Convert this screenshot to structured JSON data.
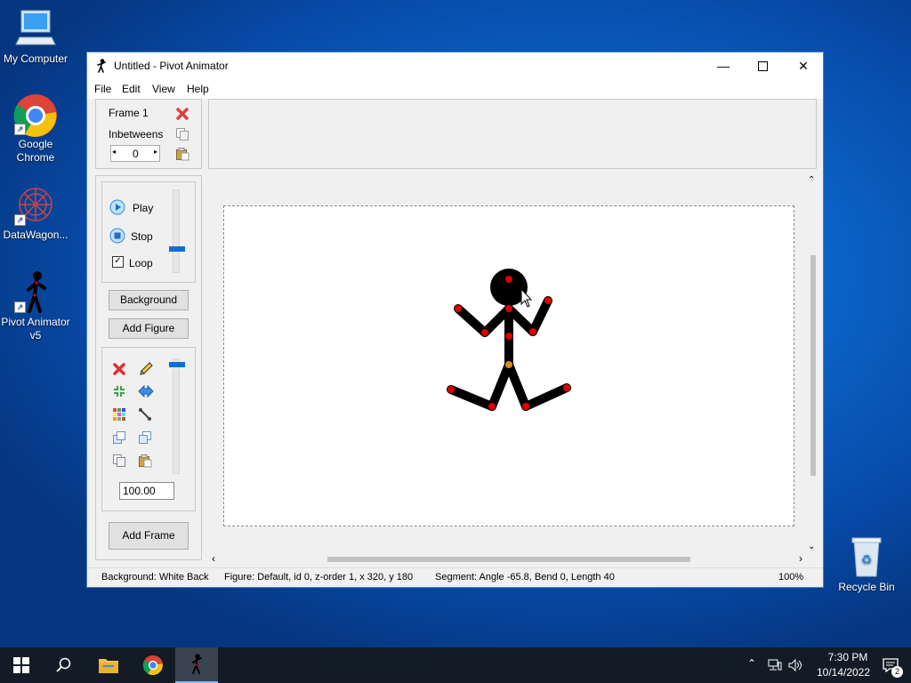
{
  "desktop": {
    "icons": [
      {
        "label": "My Computer"
      },
      {
        "label": "Google Chrome"
      },
      {
        "label": "DataWagon..."
      },
      {
        "label": "Pivot Animator v5"
      },
      {
        "label": "Recycle Bin"
      }
    ]
  },
  "window": {
    "title": "Untitled - Pivot Animator",
    "menu": [
      "File",
      "Edit",
      "View",
      "Help"
    ]
  },
  "frame_panel": {
    "frame_label": "Frame 1",
    "inbetweens_label": "Inbetweens",
    "inbetweens_value": "0"
  },
  "playback": {
    "play_label": "Play",
    "stop_label": "Stop",
    "loop_label": "Loop",
    "loop_checked": true
  },
  "buttons": {
    "background": "Background",
    "add_figure": "Add Figure",
    "add_frame": "Add Frame"
  },
  "figure_tools": {
    "scale_value": "100.00"
  },
  "statusbar": {
    "background": "Background: White Back",
    "figure": "Figure: Default,  id 0,  z-order 1,  x 320, y 180",
    "segment": "Segment: Angle -65.8,  Bend 0,  Length 40",
    "zoom": "100%"
  },
  "taskbar": {
    "time": "7:30 PM",
    "date": "10/14/2022",
    "notification_count": "2"
  },
  "colors": {
    "accent": "#0b6fd6",
    "joint": "#e00000",
    "root_joint": "#e08a1a"
  }
}
